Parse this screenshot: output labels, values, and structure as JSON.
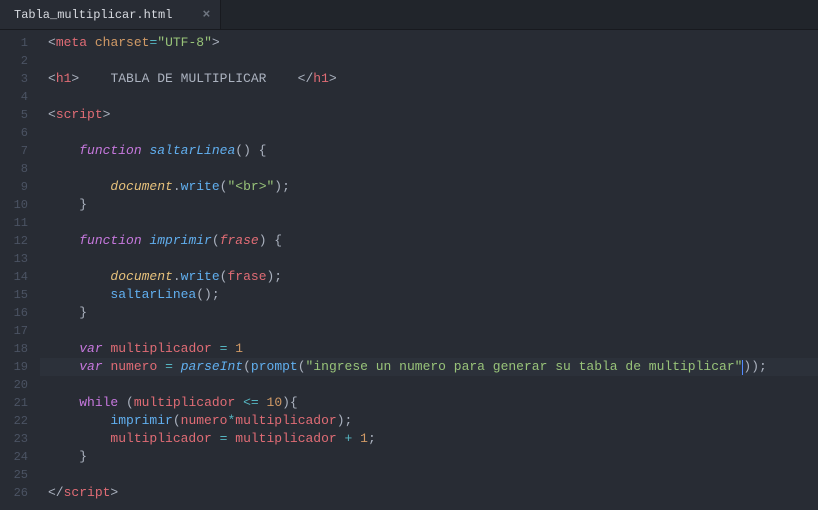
{
  "tab": {
    "title": "Tabla_multiplicar.html",
    "close": "×"
  },
  "gutter": [
    "1",
    "2",
    "3",
    "4",
    "5",
    "6",
    "7",
    "8",
    "9",
    "10",
    "11",
    "12",
    "13",
    "14",
    "15",
    "16",
    "17",
    "18",
    "19",
    "20",
    "21",
    "22",
    "23",
    "24",
    "25",
    "26"
  ],
  "highlight_line": 19,
  "code": {
    "l1": {
      "meta": "meta",
      "charset": "charset",
      "eq": "=",
      "val": "\"UTF-8\""
    },
    "l3": {
      "h1o": "h1",
      "content": "    TABLA DE MULTIPLICAR    ",
      "h1c": "h1"
    },
    "l5": {
      "script": "script"
    },
    "l7": {
      "fn": "function",
      "name": "saltarLinea"
    },
    "l9": {
      "obj": "document",
      "dot": ".",
      "m": "write",
      "arg": "\"<br>\""
    },
    "l12": {
      "fn": "function",
      "name": "imprimir",
      "p": "frase"
    },
    "l14": {
      "obj": "document",
      "dot": ".",
      "m": "write",
      "arg": "frase"
    },
    "l15": {
      "call": "saltarLinea"
    },
    "l18": {
      "var": "var",
      "n": "multiplicador",
      "eq": "=",
      "v": "1"
    },
    "l19": {
      "var": "var",
      "n": "numero",
      "eq": "=",
      "pi": "parseInt",
      "pr": "prompt",
      "s": "\"ingrese un numero para generar su tabla de multiplicar\""
    },
    "l21": {
      "wh": "while",
      "a": "multiplicador",
      "op": "<=",
      "b": "10"
    },
    "l22": {
      "call": "imprimir",
      "a": "numero",
      "op": "*",
      "b": "multiplicador"
    },
    "l23": {
      "a": "multiplicador",
      "eq": "=",
      "b": "multiplicador",
      "op": "+",
      "c": "1"
    },
    "l26": {
      "script": "script"
    }
  }
}
